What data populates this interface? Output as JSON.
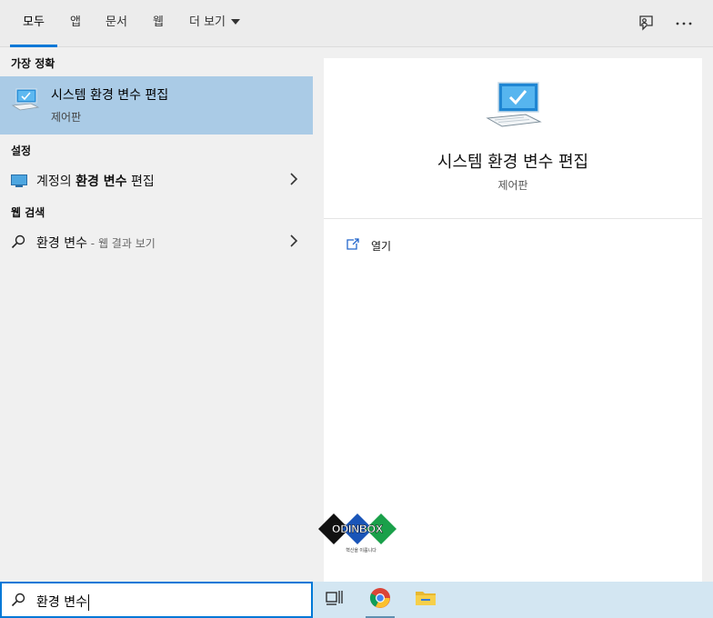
{
  "tabs": [
    {
      "label": "모두",
      "active": true
    },
    {
      "label": "앱"
    },
    {
      "label": "문서"
    },
    {
      "label": "웹"
    },
    {
      "label": "더 보기"
    }
  ],
  "sections": {
    "best_match": "가장 정확",
    "settings": "설정",
    "web_search": "웹 검색"
  },
  "best_match": {
    "title": "시스템 환경 변수 편집",
    "subtitle": "제어판"
  },
  "settings_item": {
    "prefix": "계정의 ",
    "bold": "환경 변수",
    "suffix": " 편집"
  },
  "web_item": {
    "label": "환경 변수",
    "hint": " - 웹 결과 보기"
  },
  "preview": {
    "title": "시스템 환경 변수 편집",
    "subtitle": "제어판",
    "open_label": "열기"
  },
  "logo": {
    "text": "ODINBOX",
    "tagline": "혁신을 이룹니다"
  },
  "search": {
    "value": "환경 변수"
  },
  "colors": {
    "accent": "#0078d7",
    "selected_bg": "#aacbe6",
    "taskbar_bg": "#d3e6f2"
  }
}
